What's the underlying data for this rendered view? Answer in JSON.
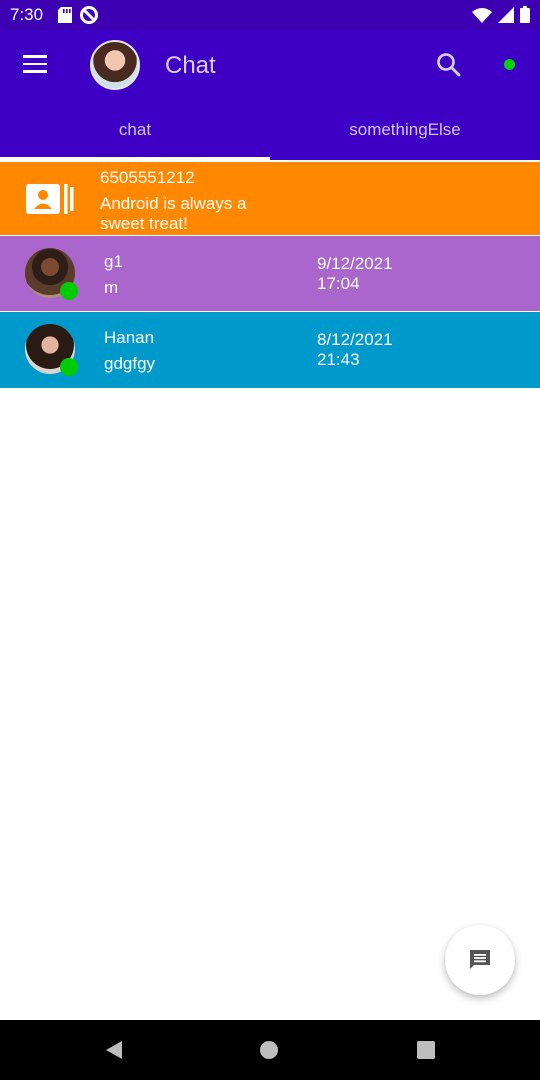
{
  "status_bar": {
    "time": "7:30",
    "icons": [
      "sd-card-icon",
      "do-not-disturb-icon",
      "wifi-icon",
      "signal-icon",
      "battery-icon"
    ]
  },
  "app_bar": {
    "title": "Chat",
    "colors": {
      "status_bar": "#3d00b3",
      "app_bar": "#3f00c6",
      "online_dot": "#00d400"
    }
  },
  "tabs": [
    {
      "label": "chat",
      "selected": true
    },
    {
      "label": "somethingElse",
      "selected": false
    }
  ],
  "list": {
    "contact": {
      "name": "6505551212",
      "message": "Android is always a sweet treat!",
      "color": "#ff8800"
    },
    "chats": [
      {
        "name": "g1",
        "message": "m",
        "date": "9/12/2021",
        "time": "17:04",
        "color": "#aa66cc",
        "online": true
      },
      {
        "name": "Hanan",
        "message": "gdgfgy",
        "date": "8/12/2021",
        "time": "21:43",
        "color": "#0099cc",
        "online": true
      }
    ]
  },
  "fab": {
    "icon": "message-icon"
  },
  "nav_bar": {
    "icons": [
      "back-icon",
      "home-icon",
      "recents-icon"
    ]
  }
}
